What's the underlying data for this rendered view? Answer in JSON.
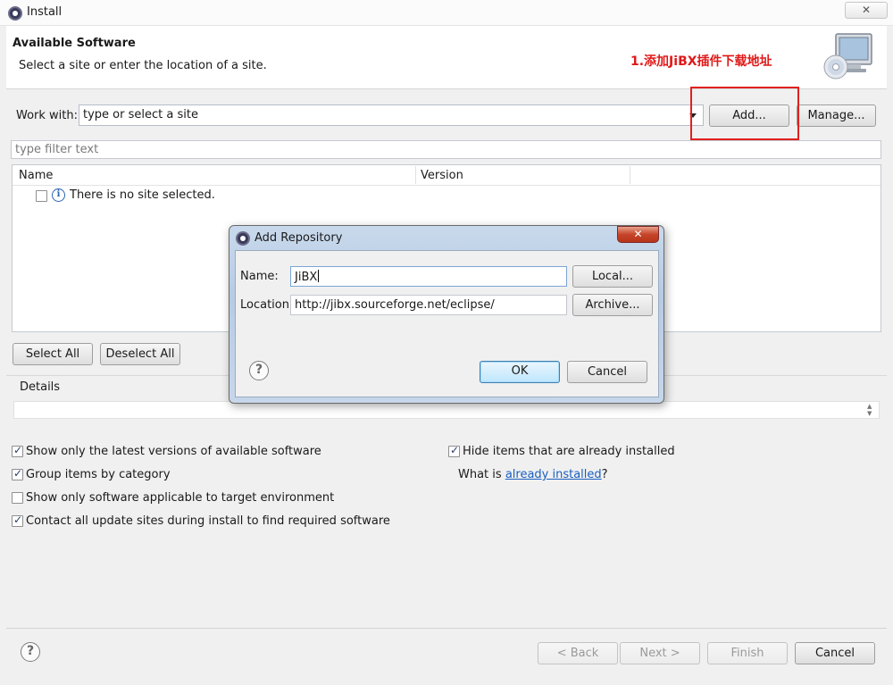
{
  "window": {
    "title": "Install",
    "close_glyph": "✕"
  },
  "header": {
    "title": "Available Software",
    "subtitle": "Select a site or enter the location of a site.",
    "annotation": "1.添加JiBX插件下载地址",
    "annotation_color": "#e01818"
  },
  "work_with": {
    "label": "Work with:",
    "value": "type or select a site",
    "add_label": "Add...",
    "manage_label": "Manage..."
  },
  "filter": {
    "placeholder": "type filter text"
  },
  "tree": {
    "columns": [
      "Name",
      "Version"
    ],
    "rows": [
      {
        "checked": false,
        "icon": "info-icon",
        "text": "There is no site selected."
      }
    ]
  },
  "selection": {
    "select_all": "Select All",
    "deselect_all": "Deselect All"
  },
  "details": {
    "label": "Details"
  },
  "options": {
    "latest_versions": {
      "label": "Show only the latest versions of available software",
      "checked": true
    },
    "group_by_category": {
      "label": "Group items by category",
      "checked": true
    },
    "applicable_only": {
      "label": "Show only software applicable to target environment",
      "checked": false
    },
    "contact_sites": {
      "label": "Contact all update sites during install to find required software",
      "checked": true
    },
    "hide_installed": {
      "label": "Hide items that are already installed",
      "checked": true
    },
    "what_is_prefix": "What is ",
    "what_is_link": "already installed",
    "what_is_suffix": "?"
  },
  "footer": {
    "back": "< Back",
    "next": "Next >",
    "finish": "Finish",
    "cancel": "Cancel"
  },
  "dialog": {
    "title": "Add Repository",
    "close_glyph": "✕",
    "name_label": "Name:",
    "name_value": "JiBX",
    "location_label": "Location:",
    "location_value": "http://jibx.sourceforge.net/eclipse/",
    "local_label": "Local...",
    "archive_label": "Archive...",
    "ok_label": "OK",
    "cancel_label": "Cancel"
  },
  "colors": {
    "accent_red": "#e02020",
    "link": "#1a5fbf"
  }
}
